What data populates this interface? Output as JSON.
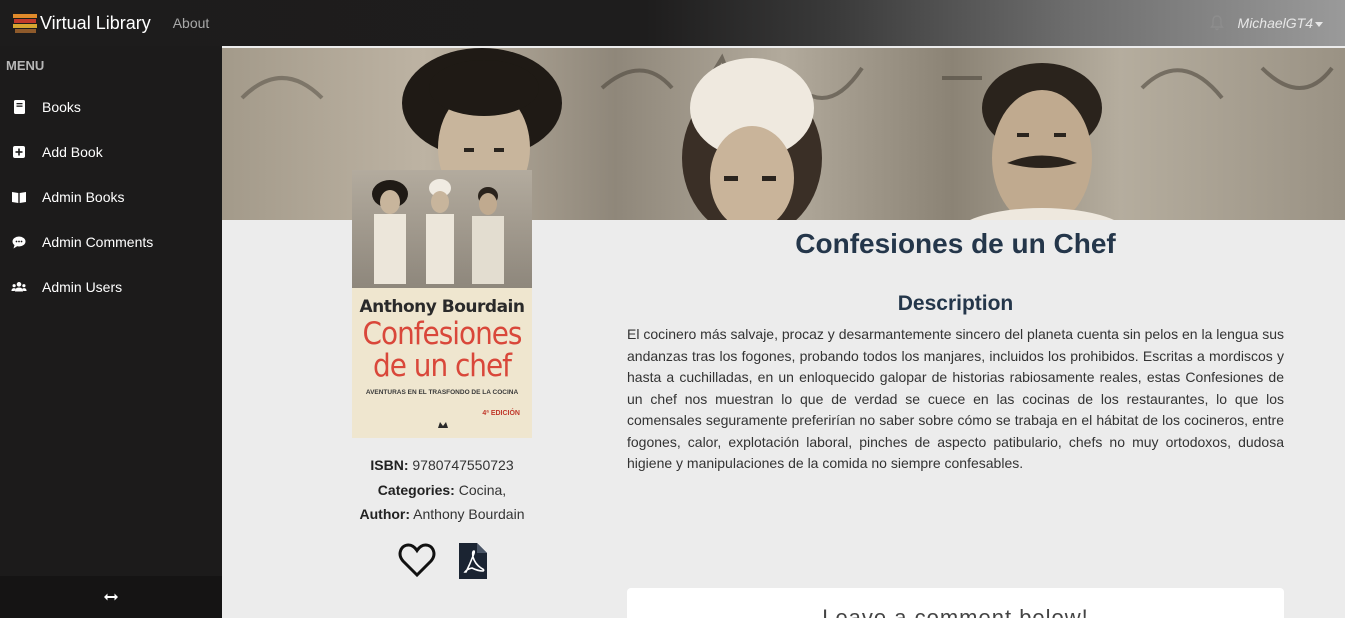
{
  "navbar": {
    "brand": "Virtual Library",
    "about": "About",
    "user": "MichaelGT4"
  },
  "sidebar": {
    "menu_title": "MENU",
    "items": [
      {
        "label": "Books",
        "icon": "book-icon"
      },
      {
        "label": "Add Book",
        "icon": "plus-square-icon"
      },
      {
        "label": "Admin Books",
        "icon": "open-book-icon"
      },
      {
        "label": "Admin Comments",
        "icon": "comment-icon"
      },
      {
        "label": "Admin Users",
        "icon": "users-icon"
      }
    ],
    "toggle_icon": "arrows-h-icon"
  },
  "cover": {
    "author": "Anthony Bourdain",
    "title_line1": "Confesiones",
    "title_line2": "de un chef",
    "subtitle": "AVENTURAS EN EL TRASFONDO DE LA COCINA",
    "edition": "4ª EDICIÓN"
  },
  "book": {
    "title": "Confesiones de un Chef",
    "isbn_label": "ISBN:",
    "isbn": "9780747550723",
    "categories_label": "Categories:",
    "categories": "Cocina,",
    "author_label": "Author:",
    "author": "Anthony Bourdain",
    "description_title": "Description",
    "description": "El cocinero más salvaje, procaz y desarmantemente sincero del planeta cuenta sin pelos en la lengua sus andanzas tras los fogones, probando todos los manjares, incluidos los prohibidos. Escritas a mordiscos y hasta a cuchilladas, en un enloquecido galopar de historias rabiosamente reales, estas Confesiones de un chef nos muestran lo que de verdad se cuece en las cocinas de los restaurantes, lo que los comensales seguramente preferirían no saber sobre cómo se trabaja en el hábitat de los cocineros, entre fogones, calor, explotación laboral, pinches de aspecto patibulario, chefs no muy ortodoxos, dudosa higiene y manipulaciones de la comida no siempre confesables."
  },
  "comments": {
    "prompt": "Leave a comment below!"
  }
}
